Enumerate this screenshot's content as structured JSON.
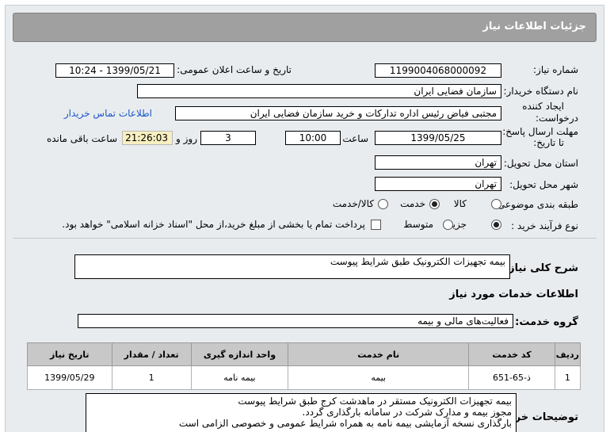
{
  "header": {
    "title": "جزئیات اطلاعات نیاز"
  },
  "need_number": {
    "label": "شماره نیاز:",
    "value": "1199004068000092"
  },
  "announce": {
    "label": "تاریخ و ساعت اعلان عمومی:",
    "value": "1399/05/21 - 10:24"
  },
  "buyer_org": {
    "label": "نام دستگاه خریدار:",
    "value": "سازمان فضایی ایران"
  },
  "requester": {
    "label_line1": "ایجاد کننده",
    "label_line2": "درخواست:",
    "value": "مجتبی  فیاض رئیس اداره تدارکات و خرید سازمان فضایی ایران",
    "contact_link": "اطلاعات تماس خریدار"
  },
  "deadline": {
    "label_line1": "مهلت ارسال پاسخ:",
    "label_line2": "تا تاریخ:",
    "date": "1399/05/25",
    "time_label": "ساعت",
    "time": "10:00",
    "days": "3",
    "days_label": "روز و",
    "remaining": "21:26:03",
    "remaining_label": "ساعت باقی مانده"
  },
  "province": {
    "label": "استان محل تحویل:",
    "value": "تهران"
  },
  "city": {
    "label": "شهر محل تحویل:",
    "value": "تهران"
  },
  "category": {
    "label": "طبقه بندی موضوعی:",
    "options": [
      "کالا",
      "خدمت",
      "کالا/خدمت"
    ],
    "selected": "خدمت"
  },
  "purchase_type": {
    "label": "نوع فرآیند خرید :",
    "options": [
      "جزیی",
      "متوسط"
    ],
    "selected": "جزیی",
    "treasury_note": "پرداخت تمام یا بخشی از مبلغ خرید،از محل \"اسناد خزانه اسلامی\" خواهد بود."
  },
  "general_desc": {
    "label": "شرح کلی نیاز:",
    "value": "بیمه تجهیزات الکترونیک طبق شرایط پیوست"
  },
  "services_title": "اطلاعات خدمات مورد نیاز",
  "service_group": {
    "label": "گروه خدمت:",
    "value": "فعالیت‌های مالی و بیمه"
  },
  "table": {
    "headers": [
      "ردیف",
      "کد خدمت",
      "نام خدمت",
      "واحد اندازه گیری",
      "تعداد / مقدار",
      "تاریخ نیاز"
    ],
    "rows": [
      [
        "1",
        "ذ-65-651",
        "بیمه",
        "بیمه نامه",
        "1",
        "1399/05/29"
      ]
    ]
  },
  "buyer_notes": {
    "label": "توضیحات خریدار:",
    "lines": [
      "بیمه تجهیزات الکترونیک مستقر در ماهدشت کرج طبق شرایط پیوست",
      "مجوز بیمه  و مدارک شرکت در سامانه بارگذاری گردد.",
      "بارگذاری نسخه آزمایشی بیمه نامه به همراه شرایط عمومی و خصوصی الزامی است"
    ]
  }
}
